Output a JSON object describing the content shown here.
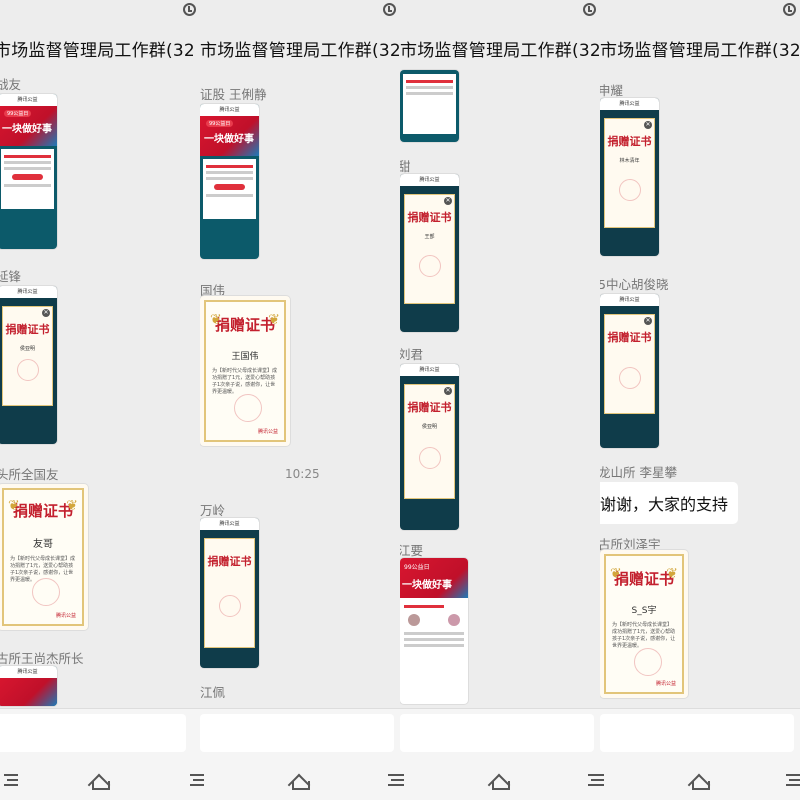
{
  "chat": {
    "group_title": "市场监督管理局工作群(32",
    "timestamp": "10:25"
  },
  "columns": [
    {
      "senders": [
        "战友",
        "延锋",
        "头所全国友",
        "古所王尚杰所长"
      ]
    },
    {
      "senders": [
        "证股  王俐静",
        "国伟",
        "万岭",
        "江佩"
      ]
    },
    {
      "senders": [
        "甜",
        "刘君",
        "江要"
      ]
    },
    {
      "senders": [
        "申耀",
        "5中心胡俊晓",
        "龙山所   李星攀",
        "古所刘泽宇"
      ],
      "text_message": "谢谢，大家的支持"
    }
  ],
  "screenshots": {
    "app_header": "腾讯公益",
    "banner_tag": "99公益日",
    "banner_big": "一块做好事",
    "banner_big2": "一块做好事"
  },
  "certificates": {
    "title": "捐赠证书",
    "names": [
      "友哥",
      "王国伟",
      "S_S宇"
    ],
    "short_names": [
      "王部",
      "林木清年",
      "侯亚明"
    ],
    "body_text": "为【新时代父母成长课堂】成功捐赠了1元，送爱心帮助孩子1次亲子说，感谢你，让世界更温暖。",
    "body_text_short": "为【新时代父母成长课堂】成功捐赠了",
    "logo": "腾讯公益"
  },
  "colors": {
    "cert_red": "#c3202e",
    "gold": "#e2c57a",
    "banner_red": "#d8162f",
    "teal_bg": "#0c5a6a"
  }
}
